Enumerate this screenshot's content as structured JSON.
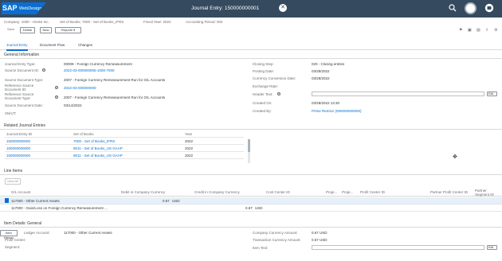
{
  "shell": {
    "logo_text": "SAP",
    "logo_tag": "WebDesign",
    "title": "Journal Entry: 150000000001",
    "close_glyph": "✕",
    "icons": [
      "search-icon",
      "notification-icon",
      "avatar",
      "help-icon"
    ]
  },
  "header": {
    "company": "Company: 1000 - Alroke Inc.",
    "set_of_books": "Set of Books: 7000 - Set of Books_IFRS",
    "fiscal_year": "Fiscal Year: 2022",
    "accounting_period": "Accounting Period: 002"
  },
  "toolbar": {
    "save": "Save",
    "delete": "Delete",
    "new": "New",
    "reports": "Reports"
  },
  "tabs": [
    "Journal Entry",
    "Document Flow",
    "Changes"
  ],
  "general": {
    "title": "General Information",
    "left": [
      {
        "label": "Journal Entry Type:",
        "value": "00009 - Foreign Currency Remeasurement",
        "link": false
      },
      {
        "label": "Source Document ID:",
        "value": "2022-03-000000005-1000-7000",
        "link": true
      },
      {
        "label": "Source Document Type:",
        "value": "2007 - Foreign Currency Remeasurement Run for G/L Accounts",
        "link": false
      },
      {
        "label": "Reference Source Document ID:",
        "value": "2022-03-000000000",
        "link": true
      },
      {
        "label": "Reference Source Document Type:",
        "value": "2007 - Foreign Currency Remeasurement Run for G/L Accounts",
        "link": false
      },
      {
        "label": "Source Document Date:",
        "value": "03/14/2022",
        "link": false
      },
      {
        "label": "SN/UT:",
        "value": "",
        "link": false
      }
    ],
    "right": [
      {
        "label": "Closing Step:",
        "value": "020 - Closing entries"
      },
      {
        "label": "Posting Date:",
        "value": "03/28/2022"
      },
      {
        "label": "Currency Conversion Date:",
        "value": "03/28/2022"
      },
      {
        "label": "Exchange Rate:",
        "value": ""
      },
      {
        "label": "Header Text:",
        "value": ""
      },
      {
        "label": "Created On:",
        "value": "03/28/2022 13:30"
      },
      {
        "label": "Created By:",
        "value": "Prime Reminz (000000000000)"
      }
    ],
    "edit_label": "Edit"
  },
  "related": {
    "title": "Related Journal Entries",
    "columns": [
      "Journal Entry ID",
      "Set of Books",
      "Year"
    ],
    "rows": [
      [
        "150000000000",
        "7000 - Set of Books_IFRS",
        "2022"
      ],
      [
        "150000000000",
        "9011 - Set of Books_US GAAP",
        "2022"
      ],
      [
        "150000000000",
        "9011 - Set of Books_US GAAP",
        "2022"
      ]
    ]
  },
  "line_items": {
    "title": "Line Items",
    "view_all": "View All",
    "columns": [
      "G/L Account",
      "Debit in Company Currency",
      "Credit in Company Currency",
      "Cost Center ID",
      "Proje...",
      "Proje...",
      "Profit Center ID",
      "Partner Profit Center ID",
      "Partner Segment ID"
    ],
    "rows": [
      {
        "gl": "117000 - Other Current Assets",
        "debit": "0.67",
        "debit_cur": "USD",
        "credit": "",
        "credit_cur": ""
      },
      {
        "gl": "117000 - Gain/Loss on Foreign Currency Remeasurement ...",
        "debit": "",
        "debit_cur": "",
        "credit": "0.67",
        "credit_cur": "USD"
      }
    ]
  },
  "item_details": {
    "title": "Item Details: General",
    "button": "Item History",
    "left": [
      {
        "label": "Ledger Account:",
        "value": "117000 - Other Current Assets"
      },
      {
        "label": "Profit Center:",
        "value": ""
      },
      {
        "label": "Segment:",
        "value": ""
      }
    ],
    "right": [
      {
        "label": "Company Currency Amount:",
        "value": "0.67 USD"
      },
      {
        "label": "Transaction Currency Amount:",
        "value": "0.67 USD"
      },
      {
        "label": "Item Text:",
        "value": ""
      }
    ],
    "edit_label": "Edit"
  }
}
